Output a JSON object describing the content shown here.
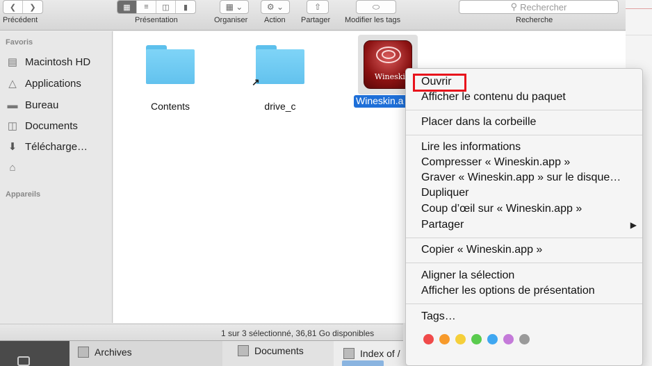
{
  "toolbar": {
    "back_label": "Précédent",
    "view_label": "Présentation",
    "arrange_label": "Organiser",
    "action_label": "Action",
    "share_label": "Partager",
    "tags_label": "Modifier les tags",
    "search_placeholder": "Rechercher",
    "search_label": "Recherche"
  },
  "sidebar": {
    "favorites_header": "Favoris",
    "items": [
      {
        "label": "Macintosh HD",
        "icon": "disk-icon"
      },
      {
        "label": "Applications",
        "icon": "applications-icon"
      },
      {
        "label": "Bureau",
        "icon": "desktop-icon"
      },
      {
        "label": "Documents",
        "icon": "documents-icon"
      },
      {
        "label": "Télécharge…",
        "icon": "download-icon"
      },
      {
        "label": "",
        "icon": "home-icon"
      }
    ],
    "devices_header": "Appareils"
  },
  "files": [
    {
      "name": "Contents"
    },
    {
      "name": "drive_c"
    },
    {
      "name": "Wineskin.a",
      "icon_text": "Wineskin"
    }
  ],
  "status": {
    "text": "1 sur 3 sélectionné, 36,81 Go disponibles"
  },
  "dock": {
    "archives": "Archives",
    "documents": "Documents",
    "index": "Index of /"
  },
  "context_menu": {
    "items": [
      "Ouvrir",
      "Afficher le contenu du paquet",
      "Placer dans la corbeille",
      "Lire les informations",
      "Compresser « Wineskin.app »",
      "Graver « Wineskin.app » sur le disque…",
      "Dupliquer",
      "Coup d’œil sur « Wineskin.app »",
      "Partager",
      "Copier « Wineskin.app »",
      "Aligner la sélection",
      "Afficher les options de présentation",
      "Tags…"
    ],
    "tag_colors": [
      "#f04a4a",
      "#f79a2b",
      "#f5cf3a",
      "#5acb4e",
      "#3fa7f1",
      "#c47ad9",
      "#9a9a9a"
    ],
    "highlight_color": "#e8131c"
  }
}
